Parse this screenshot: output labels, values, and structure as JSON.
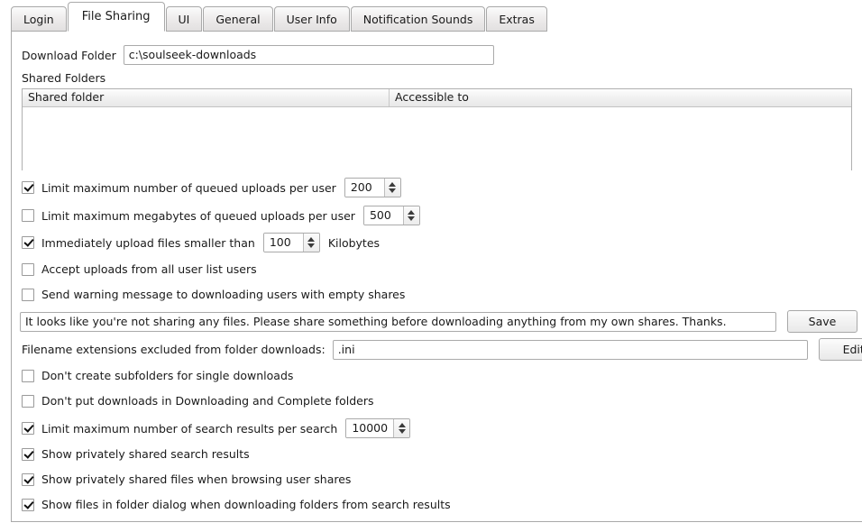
{
  "tabs": [
    {
      "label": "Login",
      "active": false
    },
    {
      "label": "File Sharing",
      "active": true
    },
    {
      "label": "UI",
      "active": false
    },
    {
      "label": "General",
      "active": false
    },
    {
      "label": "User Info",
      "active": false
    },
    {
      "label": "Notification Sounds",
      "active": false
    },
    {
      "label": "Extras",
      "active": false
    }
  ],
  "download_folder": {
    "label": "Download Folder",
    "value": "c:\\soulseek-downloads"
  },
  "shared_folders": {
    "label": "Shared Folders",
    "columns": [
      "Shared folder",
      "Accessible to"
    ],
    "rows": []
  },
  "options": {
    "queued_uploads": {
      "label": "Limit maximum number of queued uploads per user",
      "checked": true,
      "value": "200"
    },
    "queued_megabytes": {
      "label": "Limit maximum megabytes of queued uploads per user",
      "checked": false,
      "value": "500"
    },
    "immediate_upload": {
      "label": "Immediately upload files smaller than",
      "checked": true,
      "value": "100",
      "unit": "Kilobytes"
    },
    "accept_userlist": {
      "label": "Accept uploads from all user list users",
      "checked": false
    },
    "warn_empty_shares": {
      "label": "Send warning message to downloading users with empty shares",
      "checked": false
    },
    "no_subfolders": {
      "label": "Don't create subfolders for single downloads",
      "checked": false
    },
    "no_downloading_complete": {
      "label": "Don't put downloads in Downloading and Complete folders",
      "checked": false
    },
    "search_results_limit": {
      "label": "Limit maximum number of search results per search",
      "checked": true,
      "value": "10000"
    },
    "show_private_results": {
      "label": "Show privately shared search results",
      "checked": true
    },
    "show_private_browsing": {
      "label": "Show privately shared files when browsing user shares",
      "checked": true
    },
    "show_folder_dialog": {
      "label": "Show files in folder dialog when downloading folders from search results",
      "checked": true
    }
  },
  "warning_message": {
    "value": "It looks like you're not sharing any files. Please share something before downloading anything from my own shares. Thanks.",
    "button": "Save"
  },
  "excluded_extensions": {
    "label": "Filename extensions excluded from folder downloads:",
    "value": ".ini",
    "button": "Edit"
  }
}
